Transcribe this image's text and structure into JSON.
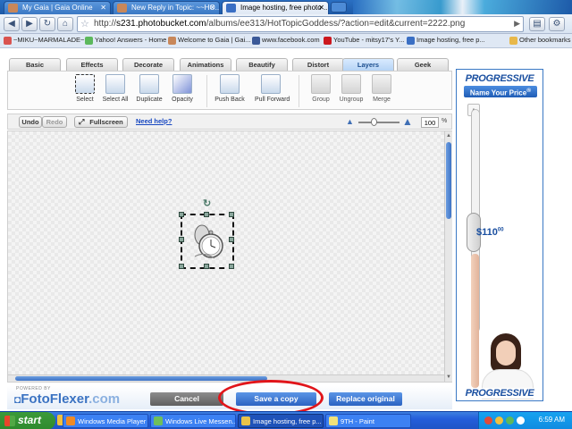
{
  "browser": {
    "tabs": [
      {
        "label": "My Gaia | Gaia Online",
        "active": false
      },
      {
        "label": "New Reply in Topic: ~~HO...",
        "active": false
      },
      {
        "label": "Image hosting, free photo ...",
        "active": true
      }
    ],
    "url_prefix": "http://",
    "url_host": "s231.photobucket.com",
    "url_path": "/albums/ee313/HotTopicGoddess/?action=edit&current=2222.png",
    "bookmarks": [
      "~MIKU~MARMALADE~",
      "Yahoo! Answers - Home",
      "Welcome to Gaia | Gai...",
      "www.facebook.com",
      "YouTube - mitsy17's Y...",
      "Image hosting, free p..."
    ],
    "other_bookmarks": "Other bookmarks"
  },
  "editor": {
    "tabs": [
      "Basic",
      "Effects",
      "Decorate",
      "Animations",
      "Beautify",
      "Distort",
      "Layers",
      "Geek"
    ],
    "active_tab": "Layers",
    "tools_left": [
      "Select",
      "Select All",
      "Duplicate",
      "Opacity"
    ],
    "tools_mid": [
      "Push Back",
      "Pull Forward"
    ],
    "tools_right": [
      "Group",
      "Ungroup",
      "Merge"
    ],
    "undo": "Undo",
    "redo": "Redo",
    "fullscreen": "Fullscreen",
    "help": "Need help?",
    "zoom": "100",
    "zoom_unit": "%"
  },
  "footer": {
    "powered_by": "POWERED BY",
    "logo": "FotoFlexer",
    "logo_suffix": ".com",
    "cancel": "Cancel",
    "save": "Save a copy",
    "replace": "Replace original"
  },
  "ad": {
    "brand": "PROGRESSIVE",
    "cta": "Name Your Price",
    "cta_mark": "®",
    "price": "$110",
    "price_cents": "00"
  },
  "taskbar": {
    "start": "start",
    "items": [
      "Windows Media Player",
      "Windows Live Messen...",
      "Image hosting, free p...",
      "9TH - Paint"
    ],
    "active_index": 2,
    "clock": "6:59 AM"
  }
}
